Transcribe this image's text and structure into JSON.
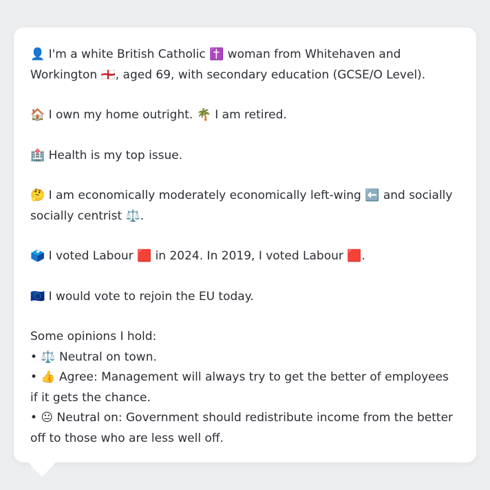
{
  "profile": {
    "identity": "👤 I'm a white British Catholic ✝️ woman from Whitehaven and Workington 🏴󠁧󠁢󠁥󠁮󠁧󠁿, aged 69, with secondary education (GCSE/O Level).",
    "home": "🏠 I own my home outright. 🌴 I am retired.",
    "issue": "🏥 Health is my top issue.",
    "ideology": "🤔 I am economically moderately economically left-wing ⬅️ and socially socially centrist ⚖️.",
    "votes": "🗳️ I voted Labour 🟥 in 2024. In 2019, I voted Labour 🟥.",
    "eu": "🇪🇺 I would vote to rejoin the EU today.",
    "opinions_header": "Some opinions I hold:",
    "opinions": [
      "• ⚖️ Neutral on town.",
      "• 👍 Agree: Management will always try to get the better of employees if it gets the chance.",
      "• 😐 Neutral on: Government should redistribute income from the better off to those who are less well off."
    ]
  }
}
